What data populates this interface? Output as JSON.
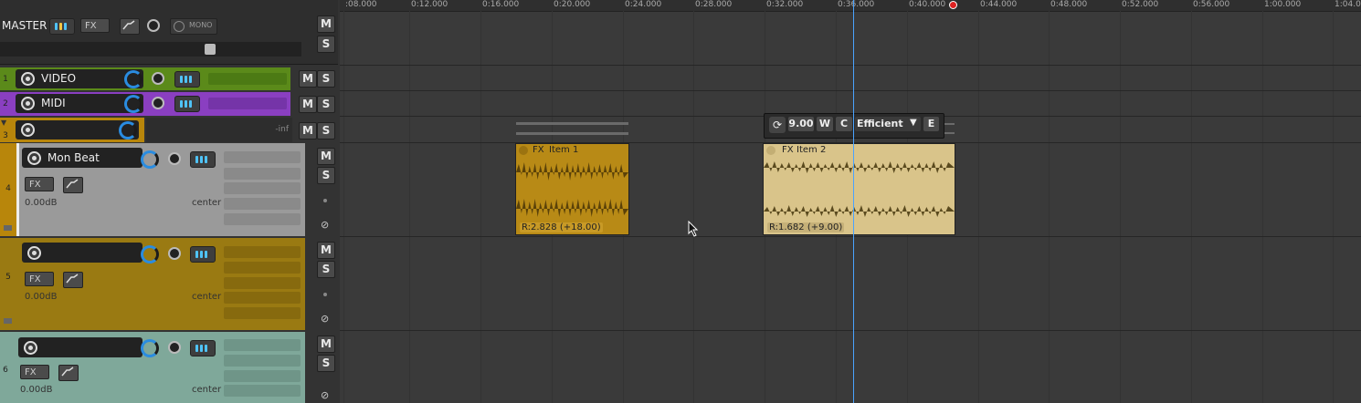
{
  "master": {
    "label": "MASTER",
    "fx_label": "FX",
    "mono_label": "MONO",
    "mute": "M",
    "solo": "S"
  },
  "timeline": {
    "ticks": [
      ":08.000",
      "0:12.000",
      "0:16.000",
      "0:20.000",
      "0:24.000",
      "0:28.000",
      "0:32.000",
      "0:36.000",
      "0:40.000",
      "0:44.000",
      "0:48.000",
      "0:52.000",
      "0:56.000",
      "1:00.000",
      "1:04.0"
    ]
  },
  "tracks": [
    {
      "num": "1",
      "name": "VIDEO",
      "color": "#5b8a1a",
      "mute": "M",
      "solo": "S"
    },
    {
      "num": "2",
      "name": "MIDI",
      "color": "#8a3fc1",
      "mute": "M",
      "solo": "S"
    },
    {
      "num": "3",
      "name": "",
      "color": "#b8860b",
      "mute": "M",
      "solo": "S",
      "vu_label": "-inf"
    },
    {
      "num": "4",
      "name": "Mon Beat",
      "color": "#9a9a9a",
      "mute": "M",
      "solo": "S",
      "fx": "FX",
      "volume": "0.00dB",
      "pan": "center"
    },
    {
      "num": "5",
      "name": "",
      "color": "#9a7a12",
      "mute": "M",
      "solo": "S",
      "fx": "FX",
      "volume": "0.00dB",
      "pan": "center"
    },
    {
      "num": "6",
      "name": "",
      "color": "#7fa89a",
      "mute": "M",
      "solo": "S",
      "fx": "FX",
      "volume": "0.00dB",
      "pan": "center"
    }
  ],
  "items": [
    {
      "title": "Item 1",
      "fx": "FX",
      "rate_label": "R:2.828 (+18.00)",
      "color": "#b88a16"
    },
    {
      "title": "Item 2",
      "fx": "FX",
      "rate_label": "R:1.682 (+9.00)",
      "color": "#d9c48a"
    }
  ],
  "item_toolbar": {
    "pitch": "9.00",
    "w": "W",
    "c": "C",
    "mode": "Efficient",
    "e": "E"
  }
}
